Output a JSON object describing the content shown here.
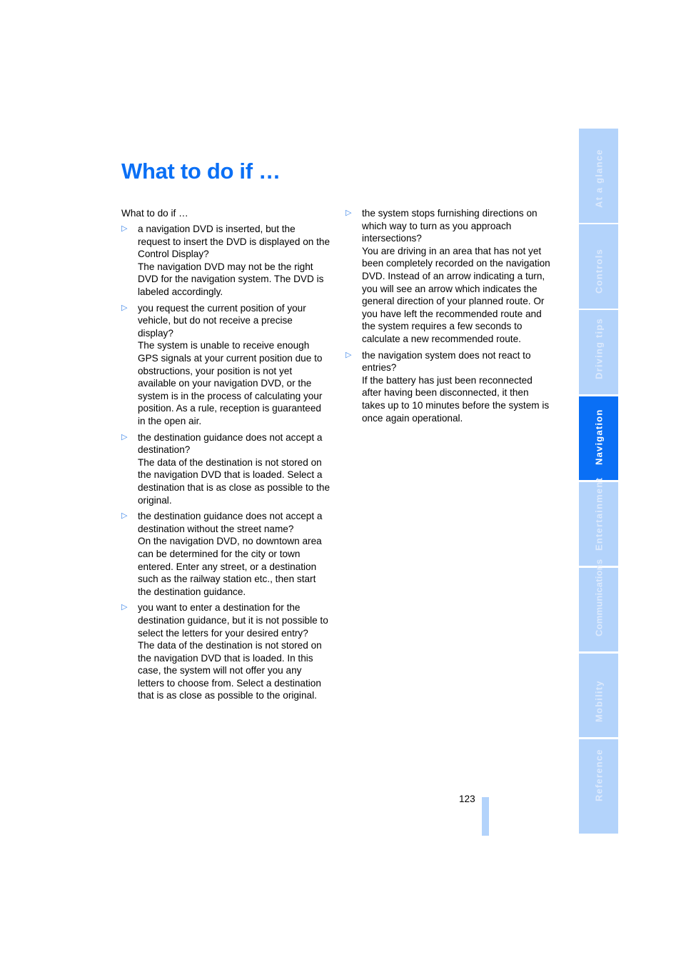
{
  "page": {
    "title": "What to do if …",
    "page_number": "123",
    "accent_color": "#0a6ff5",
    "tab_color": "#b3d3fb"
  },
  "left_column": {
    "intro": "What to do if …",
    "items": [
      {
        "question": "a navigation DVD is inserted, but the request to insert the DVD is displayed on the Control Display?",
        "answer": "The navigation DVD may not be the right DVD for the navigation system. The DVD is labeled accordingly."
      },
      {
        "question": "you request the current position of your vehicle, but do not receive a precise display?",
        "answer": "The system is unable to receive enough GPS signals at your current position due to obstructions, your position is not yet available on your navigation DVD, or the system is in the process of calculating your position. As a rule, reception is guaranteed in the open air."
      },
      {
        "question": "the destination guidance does not accept a destination?",
        "answer": "The data of the destination is not stored on the navigation DVD that is loaded. Select a destination that is as close as possible to the original."
      },
      {
        "question": "the destination guidance does not accept a destination without the street name?",
        "answer": "On the navigation DVD, no downtown area can be determined for the city or town entered. Enter any street, or a destination such as the railway station etc., then start the destination guidance."
      },
      {
        "question": "you want to enter a destination for the destination guidance, but it is not possible to select the letters for your desired entry?",
        "answer": "The data of the destination is not stored on the navigation DVD that is loaded. In this case, the system will not offer you any letters to choose from. Select a destination that is as close as possible to the original."
      }
    ]
  },
  "right_column": {
    "items": [
      {
        "question": "the system stops furnishing directions on which way to turn as you approach intersections?",
        "answer": "You are driving in an area that has not yet been completely recorded on the navigation DVD. Instead of an arrow indicating a turn, you will see an arrow which indicates the general direction of your planned route. Or you have left the recommended route and the system requires a few seconds to calculate a new recommended route."
      },
      {
        "question": "the navigation system does not react to entries?",
        "answer": "If the battery has just been reconnected after having been disconnected, it then takes up to 10 minutes before the system is once again operational."
      }
    ]
  },
  "bullet_icon": "▷",
  "tabs": [
    {
      "label": "At a glance",
      "active": false
    },
    {
      "label": "Controls",
      "active": false
    },
    {
      "label": "Driving tips",
      "active": false
    },
    {
      "label": "Navigation",
      "active": true
    },
    {
      "label": "Entertainment",
      "active": false
    },
    {
      "label": "Communications",
      "active": false
    },
    {
      "label": "Mobility",
      "active": false
    },
    {
      "label": "Reference",
      "active": false
    }
  ]
}
